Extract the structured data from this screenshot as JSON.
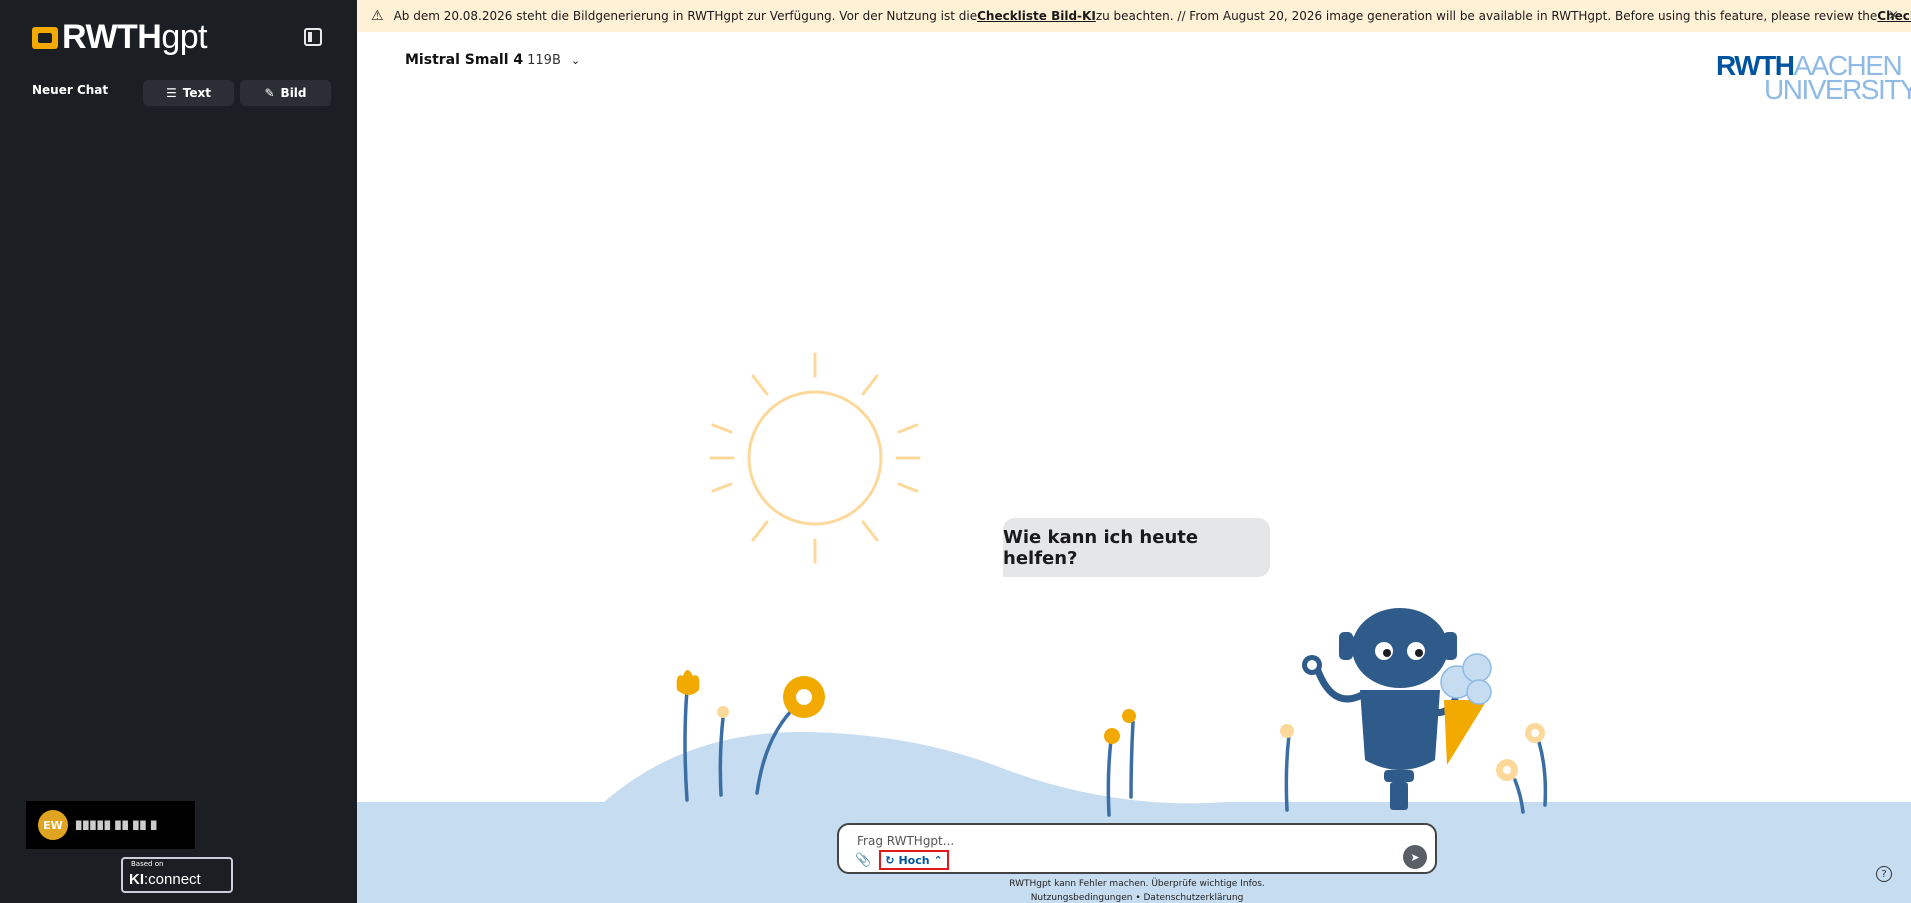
{
  "sidebar": {
    "logo_bold": "RWTH",
    "logo_light": "gpt",
    "new_chat_label": "Neuer Chat",
    "text_button_label": "Text",
    "image_button_label": "Bild",
    "user_initials": "EW",
    "user_name": "▉▉▉▉▉ ▉▉ ▉▉ ▉",
    "based_on_label": "Based on",
    "based_on_logo_bold": "KI",
    "based_on_logo_light": ":connect"
  },
  "banner": {
    "text_1": "Ab dem 20.08.2026 steht die Bildgenerierung in RWTHgpt zur Verfügung. Vor der Nutzung ist die ",
    "link_1": "Checkliste Bild-KI",
    "text_2": " zu beachten. // From August 20, 2026 image generation will be available in RWTHgpt. Before using this feature, please review the ",
    "link_2": "Checklist Image-AI",
    "text_3": ".",
    "close": "×"
  },
  "model": {
    "name": "Mistral Small 4",
    "size": "119B"
  },
  "brand": {
    "line1_bold": "RWTH",
    "line1_light": "AACHEN",
    "line2": "UNIVERSITY"
  },
  "chat": {
    "greeting": "Wie kann ich heute helfen?",
    "input_placeholder": "Frag RWTHgpt...",
    "reasoning_label": "Hoch",
    "disclaimer": "RWTHgpt kann Fehler machen. Überprüfe wichtige Infos.",
    "terms": "Nutzungsbedingungen",
    "separator": "•",
    "privacy": "Datenschutzerklärung",
    "help": "?"
  },
  "colors": {
    "sidebar_bg": "#1b1e22",
    "banner_bg": "#fff1d6",
    "accent_blue": "#00549f",
    "light_blue": "#8ebae5",
    "hill": "#c6dcf0",
    "sun": "#fcd99a",
    "flower": "#f2a900",
    "robot": "#2f5b8a"
  },
  "icons": {
    "collapse": "sidebar-collapse-icon",
    "text": "text-plus-icon",
    "image": "image-plus-icon",
    "warning": "warning-icon",
    "chevron": "chevron-down-icon",
    "attach": "paperclip-icon",
    "reasoning": "refresh-icon",
    "send": "send-icon"
  }
}
